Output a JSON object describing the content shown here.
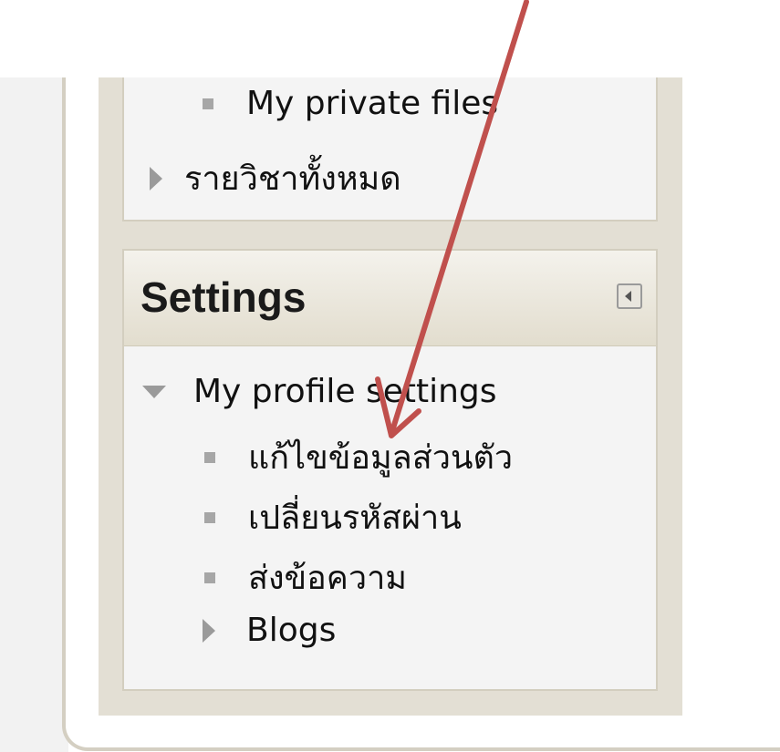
{
  "navigation": {
    "items": [
      {
        "label": "My private files",
        "type": "bullet"
      },
      {
        "label": "รายวิชาทั้งหมด",
        "type": "collapsed"
      }
    ]
  },
  "settings": {
    "title": "Settings",
    "dock_icon": "dock-left-icon",
    "profile_section": {
      "label": "My profile settings",
      "expanded": true,
      "items": [
        {
          "label": "แก้ไขข้อมูลส่วนตัว",
          "type": "bullet"
        },
        {
          "label": "เปลี่ยนรหัสผ่าน",
          "type": "bullet"
        },
        {
          "label": "ส่งข้อความ",
          "type": "bullet"
        },
        {
          "label": "Blogs",
          "type": "collapsed"
        }
      ]
    }
  },
  "annotation": {
    "arrow_color": "#c0504d",
    "icon": "annotation-arrow"
  },
  "colors": {
    "block_bg": "#f4f4f4",
    "column_bg": "#e3dfd4",
    "border": "#d3cebf"
  }
}
